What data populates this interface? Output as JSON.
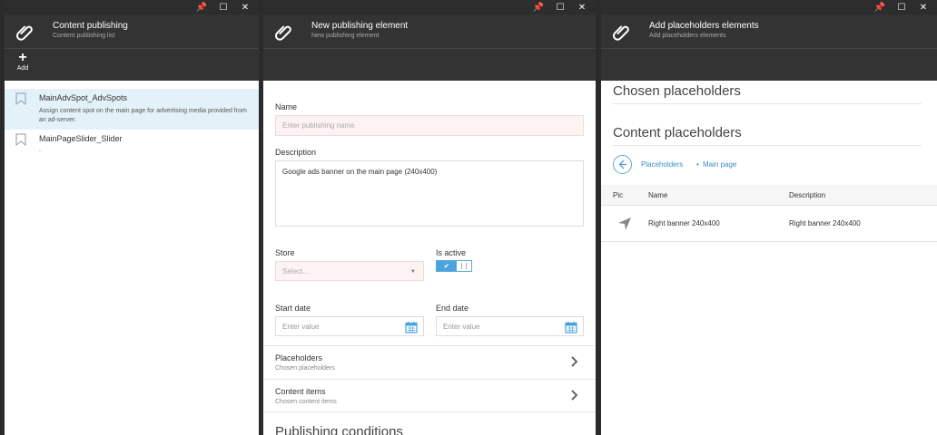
{
  "window_controls": {
    "pin": "📌",
    "maximize": "☐",
    "close": "✕"
  },
  "blade1": {
    "title": "Content publishing",
    "subtitle": "Content publishing list",
    "toolbar": {
      "add_label": "Add"
    },
    "items": [
      {
        "title": "MainAdvSpot_AdvSpots",
        "description": "Assign content spot on the main page for advertising media provided from an ad-server.",
        "selected": true
      },
      {
        "title": "MainPageSlider_Slider",
        "description": ".",
        "selected": false
      }
    ]
  },
  "blade2": {
    "title": "New publishing element",
    "subtitle": "New publishing element",
    "name_label": "Name",
    "name_placeholder": "Enter publishing name",
    "description_label": "Description",
    "description_value": "Google ads banner on the main page (240x400)",
    "store_label": "Store",
    "store_placeholder": "Select...",
    "is_active_label": "Is active",
    "is_active": true,
    "start_date_label": "Start date",
    "start_date_placeholder": "Enter value",
    "end_date_label": "End date",
    "end_date_placeholder": "Enter value",
    "sections": [
      {
        "title": "Placeholders",
        "subtitle": "Chosen placeholders"
      },
      {
        "title": "Content items",
        "subtitle": "Chosen content items"
      }
    ],
    "publishing_conditions_heading": "Publishing conditions"
  },
  "blade3": {
    "title": "Add placeholders elements",
    "subtitle": "Add placeholders elements",
    "chosen_heading": "Chosen placeholders",
    "content_heading": "Content placeholders",
    "breadcrumb": [
      "Placeholders",
      "Main page"
    ],
    "breadcrumb_sep": "•",
    "columns": [
      "Pic",
      "Name",
      "Description"
    ],
    "rows": [
      {
        "name": "Right banner 240x400",
        "description": "Right banner 240x400"
      }
    ]
  },
  "colors": {
    "header_bg": "#333333",
    "accent": "#4aa3df",
    "selected_row": "#e3f2f8",
    "required_field": "#fdf3f3"
  },
  "icons": {
    "header": "paperclip-icon",
    "list_item": "bookmark-icon",
    "date": "calendar-icon",
    "nav": "chevron-right-icon",
    "row": "location-arrow-icon"
  }
}
